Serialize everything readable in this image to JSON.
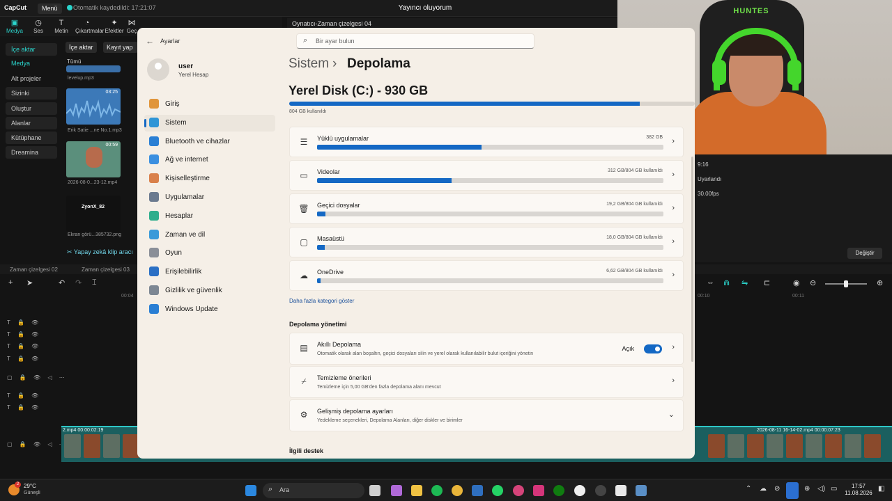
{
  "capcut": {
    "logo": "CapCut",
    "menu": "Menü",
    "saved": "Otomatik kaydedildi: 17:21:07",
    "window_title": "Yayıncı oluyorum",
    "tools": [
      {
        "icon": "media-icon",
        "label": "Medya"
      },
      {
        "icon": "audio-icon",
        "label": "Ses"
      },
      {
        "icon": "text-icon",
        "label": "Metin"
      },
      {
        "icon": "sticker-icon",
        "label": "Çıkartmalar"
      },
      {
        "icon": "effects-icon",
        "label": "Efektler"
      },
      {
        "icon": "transitions-icon",
        "label": "Geç"
      }
    ],
    "left_nav": [
      "İçe aktar",
      "Medya",
      "Alt projeler",
      "Sizinki",
      "Oluştur",
      "Alanlar",
      "Kütüphane",
      "Dreamina"
    ],
    "import_btn": "İçe aktar",
    "record_btn": "Kayıt yap",
    "filter": "Tümü",
    "thumbs": [
      {
        "caption": "levelup.mp3",
        "dur": ""
      },
      {
        "caption": "Erik Satie ...ne No.1.mp3",
        "dur": "03:25"
      },
      {
        "caption": "2026-08-0...23-12.mp4",
        "dur": "00:59"
      },
      {
        "caption": "Ekran görü...385732.png",
        "dur": ""
      }
    ],
    "thumb_overlay": "ZyonX_82",
    "ai_clip": "Yapay zekâ klip aracı",
    "player_tab": "Oynatıcı-Zaman çizelgesi 04",
    "right_panel": {
      "ratio": "9:16",
      "adjusted": "Uyarlandı",
      "fps": "30.00fps",
      "change_btn": "Değiştir"
    },
    "timeline_tabs": [
      "Zaman çizelgesi 02",
      "Zaman çizelgesi 03"
    ],
    "ruler": [
      "00:04",
      "00:10",
      "00:11"
    ],
    "film_left_caption": "2.mp4  00:00:02:19",
    "film_right_caption": "2026-08-11 16-14-02.mp4  00:00:07:23"
  },
  "settings": {
    "app_title": "Ayarlar",
    "search_placeholder": "Bir ayar bulun",
    "user": {
      "name": "user",
      "type": "Yerel Hesap"
    },
    "nav": [
      {
        "label": "Giriş",
        "icon": "home-icon",
        "color": "#e0953a"
      },
      {
        "label": "Sistem",
        "icon": "system-icon",
        "color": "#2f95d6",
        "active": true
      },
      {
        "label": "Bluetooth ve cihazlar",
        "icon": "bluetooth-icon",
        "color": "#2a7fd4"
      },
      {
        "label": "Ağ ve internet",
        "icon": "network-icon",
        "color": "#3b8fe0"
      },
      {
        "label": "Kişiselleştirme",
        "icon": "brush-icon",
        "color": "#d9804a"
      },
      {
        "label": "Uygulamalar",
        "icon": "apps-icon",
        "color": "#6b7a8f"
      },
      {
        "label": "Hesaplar",
        "icon": "accounts-icon",
        "color": "#2eae8c"
      },
      {
        "label": "Zaman ve dil",
        "icon": "time-icon",
        "color": "#3a9ad9"
      },
      {
        "label": "Oyun",
        "icon": "gaming-icon",
        "color": "#8a8f98"
      },
      {
        "label": "Erişilebilirlik",
        "icon": "accessibility-icon",
        "color": "#2a6fc4"
      },
      {
        "label": "Gizlilik ve güvenlik",
        "icon": "shield-icon",
        "color": "#7d8793"
      },
      {
        "label": "Windows Update",
        "icon": "update-icon",
        "color": "#2a7fd4"
      }
    ],
    "breadcrumb_parent": "Sistem",
    "breadcrumb_sep": "›",
    "breadcrumb_current": "Depolama",
    "disk_title": "Yerel Disk (C:) - 930 GB",
    "disk_used_fraction": 0.864,
    "disk_used": "804 GB kullanıldı",
    "categories": [
      {
        "name": "Yüklü uygulamalar",
        "value": "382 GB",
        "fraction": 0.475,
        "icon": "list-icon"
      },
      {
        "name": "Videolar",
        "value": "312 GB/804 GB kullanıldı",
        "fraction": 0.388,
        "icon": "video-icon"
      },
      {
        "name": "Geçici dosyalar",
        "value": "19,2 GB/804 GB kullanıldı",
        "fraction": 0.024,
        "icon": "trash-icon"
      },
      {
        "name": "Masaüstü",
        "value": "18,0 GB/804 GB kullanıldı",
        "fraction": 0.022,
        "icon": "monitor-icon"
      },
      {
        "name": "OneDrive",
        "value": "6,62 GB/804 GB kullanıldı",
        "fraction": 0.008,
        "icon": "cloud-icon"
      }
    ],
    "more_link": "Daha fazla kategori göster",
    "management_title": "Depolama yönetimi",
    "management": [
      {
        "name": "Akıllı Depolama",
        "desc": "Otomatik olarak alan boşaltın, geçici dosyaları silin ve yerel olarak kullanılabilir bulut içeriğini yönetin",
        "state": "Açık",
        "icon": "drive-icon"
      },
      {
        "name": "Temizleme önerileri",
        "desc": "Temizleme için 5,00 GB'den fazla depolama alanı mevcut",
        "icon": "broom-icon"
      },
      {
        "name": "Gelişmiş depolama ayarları",
        "desc": "Yedekleme seçenekleri, Depolama Alanları, diğer diskler ve birimler",
        "icon": "gear-icon"
      }
    ],
    "related_title": "İlgili destek"
  },
  "webcam": {
    "brand": "HUNTES"
  },
  "taskbar": {
    "temp": "29°C",
    "weather": "Güneşli",
    "badge": "2",
    "search_placeholder": "Ara",
    "time": "17:57",
    "date": "11.08.2026"
  }
}
